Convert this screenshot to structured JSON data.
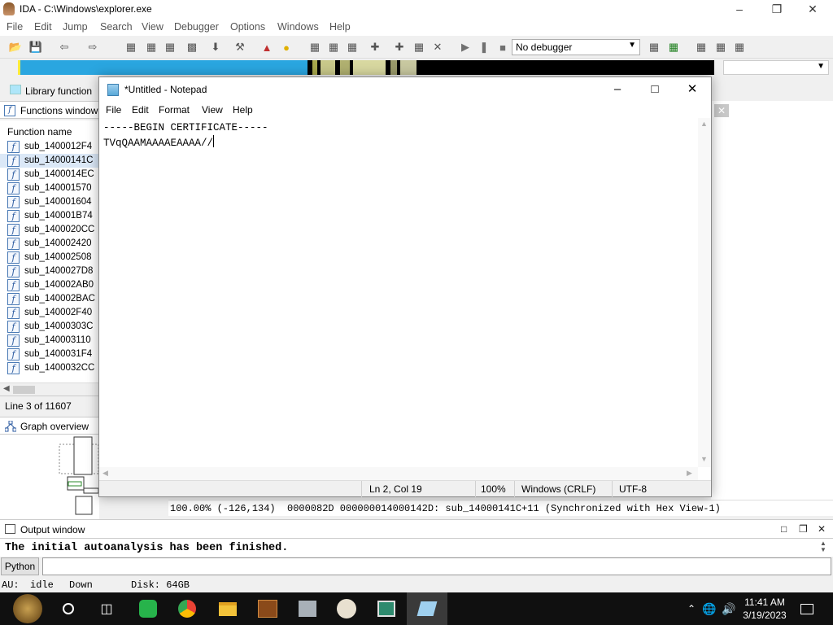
{
  "ida": {
    "title": "IDA - C:\\Windows\\explorer.exe",
    "menu": [
      "File",
      "Edit",
      "Jump",
      "Search",
      "View",
      "Debugger",
      "Options",
      "Windows",
      "Help"
    ],
    "debugger_select": "No debugger",
    "legend_label": "Library function",
    "functions_tab": "Functions window",
    "function_header": "Function name",
    "functions": [
      "sub_1400012F4",
      "sub_14000141C",
      "sub_1400014EC",
      "sub_140001570",
      "sub_140001604",
      "sub_140001B74",
      "sub_1400020CC",
      "sub_140002420",
      "sub_140002508",
      "sub_1400027D8",
      "sub_140002AB0",
      "sub_140002BAC",
      "sub_140002F40",
      "sub_14000303C",
      "sub_140003110",
      "sub_1400031F4",
      "sub_1400032CC"
    ],
    "selected_function_index": 1,
    "line_status": "Line 3 of 11607",
    "graph_tab": "Graph overview",
    "lower_status_zoom": "100.00% (-126,134)",
    "lower_status_addr": "0000082D 000000014000142D: sub_14000141C+11 (Synchronized with Hex View-1)",
    "output_tab": "Output window",
    "output_text": "The initial autoanalysis has been finished.",
    "python_button": "Python",
    "status_au": "AU:",
    "status_idle": "idle",
    "status_down": "Down",
    "status_disk": "Disk: 64GB"
  },
  "notepad": {
    "title": "*Untitled - Notepad",
    "menu": [
      "File",
      "Edit",
      "Format",
      "View",
      "Help"
    ],
    "lines": [
      "-----BEGIN CERTIFICATE-----",
      "TVqQAAMAAAAEAAAA//"
    ],
    "status": {
      "position": "Ln 2, Col 19",
      "zoom": "100%",
      "line_endings": "Windows (CRLF)",
      "encoding": "UTF-8"
    }
  },
  "taskbar": {
    "time": "11:41 AM",
    "date": "3/19/2023"
  },
  "colors": {
    "nav_blue": "#2aa6e0",
    "taskbar": "#101010",
    "selection": "#dbe8f7"
  }
}
